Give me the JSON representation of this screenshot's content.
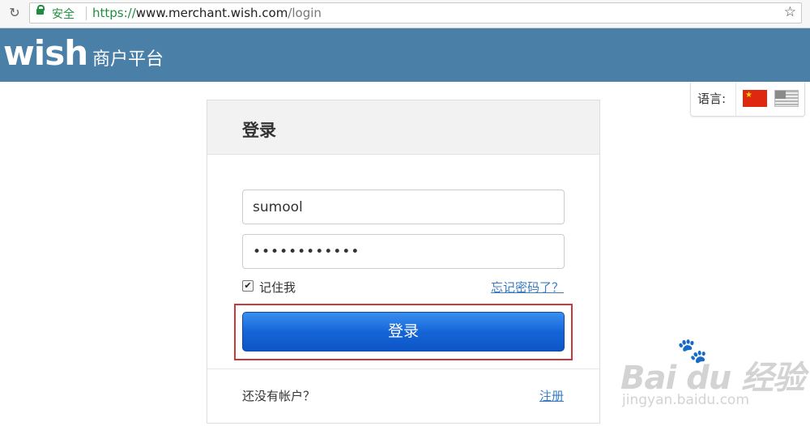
{
  "browser": {
    "secure_label": "安全",
    "url_scheme": "https://",
    "url_host": "www.merchant.wish.com",
    "url_path": "/login"
  },
  "header": {
    "logo": "wish",
    "subtitle": "商户平台",
    "background": "#4a7fa8"
  },
  "language": {
    "label": "语言:",
    "options": [
      "cn-flag-icon",
      "us-flag-icon"
    ]
  },
  "login": {
    "title": "登录",
    "username_value": "sumool",
    "password_value": "••••••••••••",
    "remember_label": "记住我",
    "remember_checked": true,
    "forgot_link": "忘记密码了？",
    "submit_label": "登录",
    "no_account_text": "还没有帐户？",
    "register_link": "注册"
  },
  "watermark": {
    "main": "Bai du 经验",
    "sub": "jingyan.baidu.com"
  }
}
